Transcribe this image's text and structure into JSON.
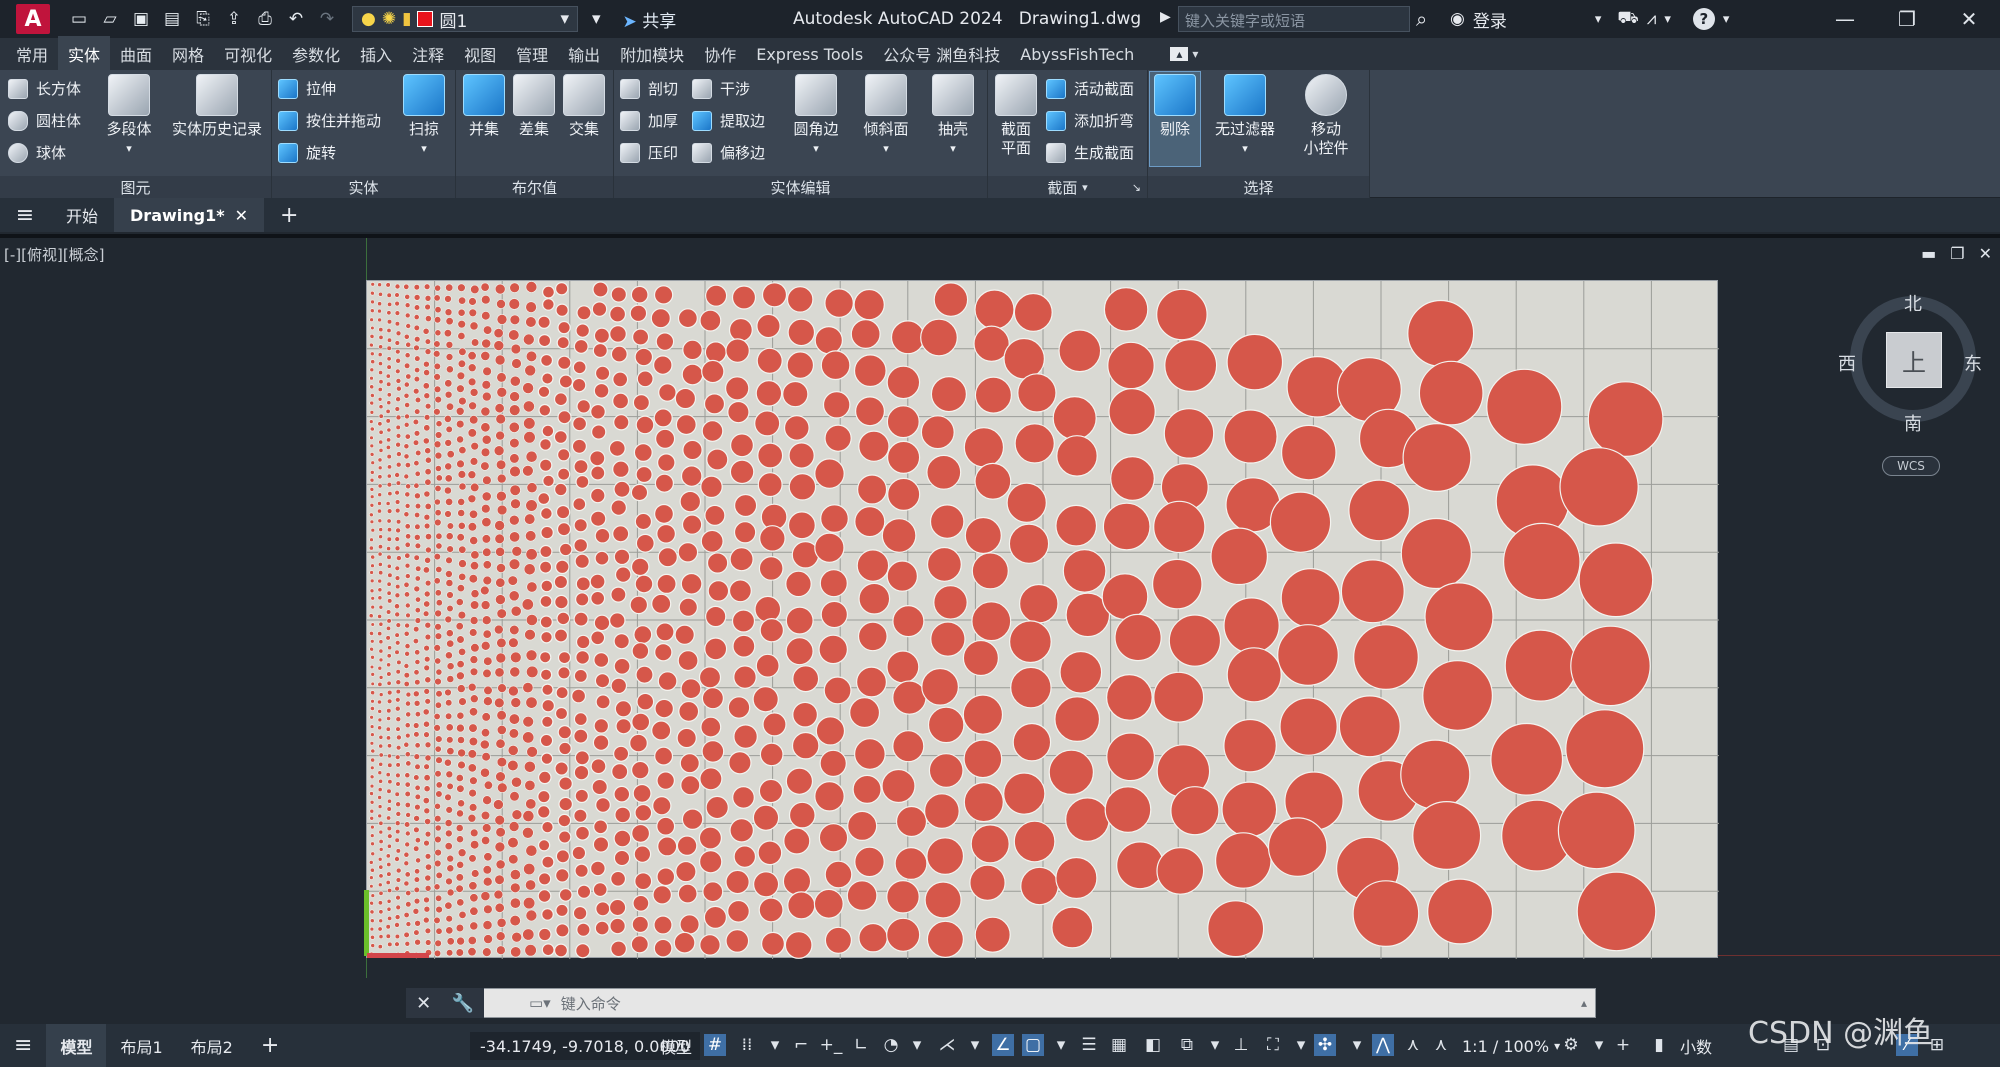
{
  "app": {
    "logo": "A",
    "title": "Autodesk AutoCAD 2024",
    "file": "Drawing1.dwg",
    "layer_name": "圆1",
    "share_label": "共享",
    "search_placeholder": "键入关键字或短语",
    "login_label": "登录"
  },
  "menu_tabs": [
    "常用",
    "实体",
    "曲面",
    "网格",
    "可视化",
    "参数化",
    "插入",
    "注释",
    "视图",
    "管理",
    "输出",
    "附加模块",
    "协作",
    "Express Tools",
    "公众号 渊鱼科技",
    "AbyssFishTech"
  ],
  "active_tab_index": 1,
  "ribbon": {
    "yuanyuan": {
      "title": "图元",
      "box": "长方体",
      "cyl": "圆柱体",
      "sphere": "球体",
      "poly": "多段体",
      "history": "实体历史记录"
    },
    "shiti": {
      "title": "实体",
      "extrude": "拉伸",
      "press": "按住并拖动",
      "revolve": "旋转",
      "sweep": "扫掠"
    },
    "boolean": {
      "title": "布尔值",
      "union": "并集",
      "subtract": "差集",
      "intersect": "交集"
    },
    "edit": {
      "title": "实体编辑",
      "slice": "剖切",
      "interfere": "干涉",
      "thicken": "加厚",
      "extract": "提取边",
      "imprint": "压印",
      "offset": "偏移边",
      "fillet": "圆角边",
      "taper": "倾斜面",
      "shell": "抽壳"
    },
    "section": {
      "title": "截面",
      "plane": "截面\n平面",
      "live": "活动截面",
      "jog": "添加折弯",
      "generate": "生成截面"
    },
    "select": {
      "title": "选择",
      "cull": "剔除",
      "nofilter": "无过滤器",
      "gizmo": "移动\n小控件"
    }
  },
  "doc_tabs": {
    "start": "开始",
    "drawing": "Drawing1*"
  },
  "viewport": {
    "label": "[-][俯视][概念]",
    "viewcube": {
      "face": "上",
      "north": "北",
      "south": "南",
      "east": "东",
      "west": "西",
      "wcs": "WCS"
    },
    "circle_color": "#d6574a",
    "grid_color": "#9b9d98",
    "sheet_color": "#d9d9d3"
  },
  "command": {
    "placeholder": "键入命令"
  },
  "status": {
    "layouts": [
      "模型",
      "布局1",
      "布局2"
    ],
    "coords": "-34.1749, -9.7018, 0.0000",
    "model": "模型",
    "scale": "1:1 / 100%",
    "units": "小数"
  },
  "watermark": "CSDN @渊鱼"
}
